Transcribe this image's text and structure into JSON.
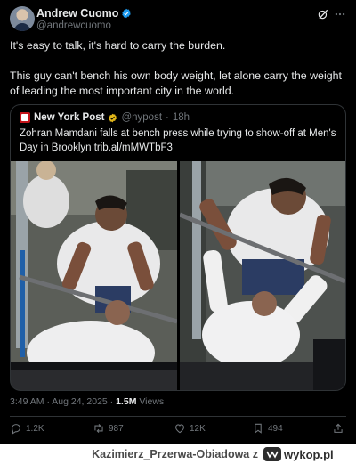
{
  "post": {
    "author": {
      "display_name": "Andrew Cuomo",
      "handle": "@andrewcuomo"
    },
    "text": [
      "It's easy to talk, it's hard to carry the burden.",
      "This guy can't bench his own body weight, let alone carry the weight of leading the most important city in the world."
    ],
    "quote": {
      "author_name": "New York Post",
      "handle": "@nypost",
      "separator": "·",
      "age": "18h",
      "text": "Zohran Mamdani falls at bench press while trying to show-off at Men's Day in Brooklyn trib.al/mMWTbF3"
    },
    "timestamp": "3:49 AM · Aug 24, 2025 · ",
    "views_count": "1.5M",
    "views_label": " Views",
    "stats": {
      "replies": "1.2K",
      "reposts": "987",
      "likes": "12K",
      "bookmarks": "494"
    },
    "colors": {
      "background": "#000000",
      "verified_blue": "#1d9bf0",
      "verified_gold": "#e2b719",
      "text": "#e7e9ea",
      "muted": "#71767b",
      "nypost_red": "#c4141a"
    },
    "icons": [
      "avatar",
      "verified-blue-icon",
      "grok-icon",
      "more-icon",
      "nypost-logo",
      "verified-gold-icon",
      "reply-icon",
      "repost-icon",
      "like-icon",
      "views-icon",
      "share-icon"
    ]
  },
  "watermark": {
    "user": "Kazimierz_Przerwa-Obiadowa",
    "connector": "z",
    "site": "wykop.pl"
  }
}
